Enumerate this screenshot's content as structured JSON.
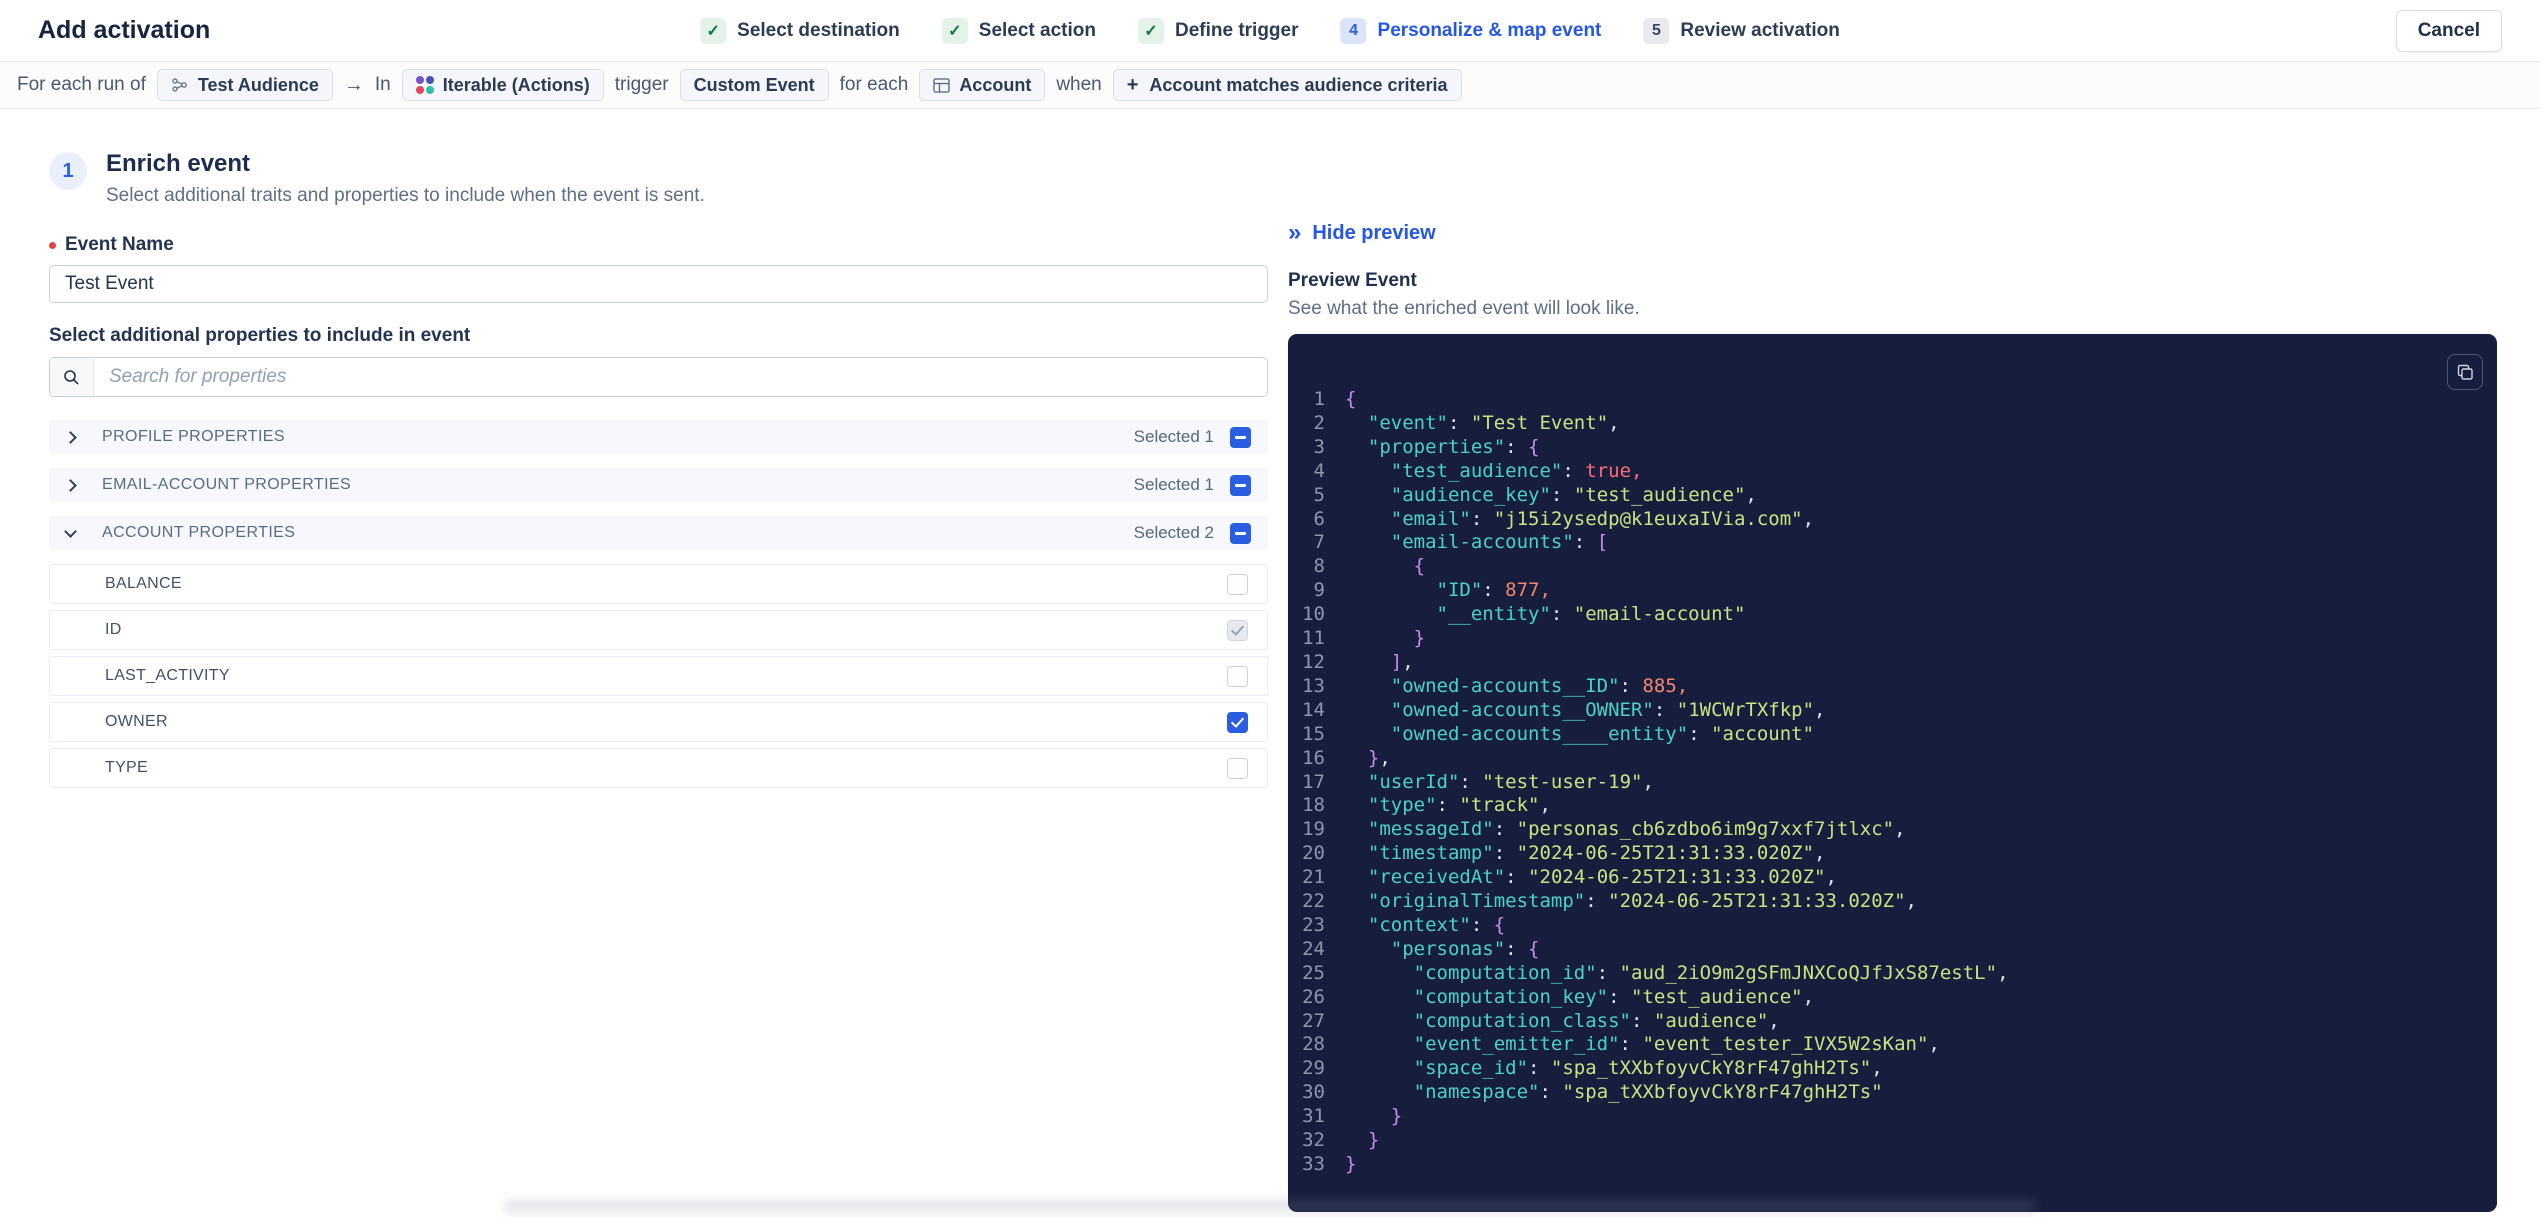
{
  "header": {
    "title": "Add activation",
    "cancel_label": "Cancel",
    "steps": [
      {
        "label": "Select destination",
        "state": "done"
      },
      {
        "label": "Select action",
        "state": "done"
      },
      {
        "label": "Define trigger",
        "state": "done"
      },
      {
        "number": "4",
        "label": "Personalize & map event",
        "state": "active"
      },
      {
        "number": "5",
        "label": "Review activation",
        "state": "upcoming"
      }
    ]
  },
  "icons": {
    "check": "✓",
    "arrow_right": "→",
    "double_chevron_right": "»",
    "plus": "+"
  },
  "context_bar": {
    "for_each_run_of": "For each run of",
    "audience_chip": "Test Audience",
    "in_label": "In",
    "destination_chip": "Iterable (Actions)",
    "trigger_label": "trigger",
    "trigger_chip": "Custom Event",
    "for_each_label": "for each",
    "entity_chip": "Account",
    "when_label": "when",
    "criteria_chip": "Account matches audience criteria"
  },
  "enrich": {
    "step_number": "1",
    "title": "Enrich event",
    "subtitle": "Select additional traits and properties to include when the event is sent.",
    "event_name_label": "Event Name",
    "event_name_value": "Test Event",
    "properties_label": "Select additional properties to include in event",
    "search_placeholder": "Search for properties",
    "groups": [
      {
        "label": "PROFILE PROPERTIES",
        "selected_text": "Selected 1",
        "state": "collapsed"
      },
      {
        "label": "EMAIL-ACCOUNT PROPERTIES",
        "selected_text": "Selected 1",
        "state": "collapsed"
      },
      {
        "label": "ACCOUNT PROPERTIES",
        "selected_text": "Selected 2",
        "state": "expanded"
      }
    ],
    "account_properties": [
      {
        "label": "BALANCE",
        "state": "unchecked"
      },
      {
        "label": "ID",
        "state": "checked-disabled"
      },
      {
        "label": "LAST_ACTIVITY",
        "state": "unchecked"
      },
      {
        "label": "OWNER",
        "state": "checked"
      },
      {
        "label": "TYPE",
        "state": "unchecked"
      }
    ]
  },
  "preview": {
    "hide_label": "Hide preview",
    "title": "Preview Event",
    "subtitle": "See what the enriched event will look like.",
    "code_lines": [
      [
        [
          "p",
          "{"
        ]
      ],
      [
        [
          "d",
          "  "
        ],
        [
          "k",
          "\"event\""
        ],
        [
          "d",
          ": "
        ],
        [
          "s",
          "\"Test Event\""
        ],
        [
          "d",
          ","
        ]
      ],
      [
        [
          "d",
          "  "
        ],
        [
          "k",
          "\"properties\""
        ],
        [
          "d",
          ": "
        ],
        [
          "p",
          "{"
        ]
      ],
      [
        [
          "d",
          "    "
        ],
        [
          "k",
          "\"test_audience\""
        ],
        [
          "d",
          ": "
        ],
        [
          "b",
          "true,"
        ]
      ],
      [
        [
          "d",
          "    "
        ],
        [
          "k",
          "\"audience_key\""
        ],
        [
          "d",
          ": "
        ],
        [
          "s",
          "\"test_audience\""
        ],
        [
          "d",
          ","
        ]
      ],
      [
        [
          "d",
          "    "
        ],
        [
          "k",
          "\"email\""
        ],
        [
          "d",
          ": "
        ],
        [
          "s",
          "\"j15i2ysedp@k1euxaIVia.com\""
        ],
        [
          "d",
          ","
        ]
      ],
      [
        [
          "d",
          "    "
        ],
        [
          "k",
          "\"email-accounts\""
        ],
        [
          "d",
          ": "
        ],
        [
          "p",
          "["
        ]
      ],
      [
        [
          "d",
          "      "
        ],
        [
          "p",
          "{"
        ]
      ],
      [
        [
          "d",
          "        "
        ],
        [
          "k",
          "\"ID\""
        ],
        [
          "d",
          ": "
        ],
        [
          "n",
          "877,"
        ]
      ],
      [
        [
          "d",
          "        "
        ],
        [
          "k",
          "\"__entity\""
        ],
        [
          "d",
          ": "
        ],
        [
          "s",
          "\"email-account\""
        ]
      ],
      [
        [
          "d",
          "      "
        ],
        [
          "p",
          "}"
        ]
      ],
      [
        [
          "d",
          "    "
        ],
        [
          "p",
          "]"
        ],
        [
          "d",
          ","
        ]
      ],
      [
        [
          "d",
          "    "
        ],
        [
          "k",
          "\"owned-accounts__ID\""
        ],
        [
          "d",
          ": "
        ],
        [
          "n",
          "885,"
        ]
      ],
      [
        [
          "d",
          "    "
        ],
        [
          "k",
          "\"owned-accounts__OWNER\""
        ],
        [
          "d",
          ": "
        ],
        [
          "s",
          "\"1WCWrTXfkp\""
        ],
        [
          "d",
          ","
        ]
      ],
      [
        [
          "d",
          "    "
        ],
        [
          "k",
          "\"owned-accounts____entity\""
        ],
        [
          "d",
          ": "
        ],
        [
          "s",
          "\"account\""
        ]
      ],
      [
        [
          "d",
          "  "
        ],
        [
          "p",
          "}"
        ],
        [
          "d",
          ","
        ]
      ],
      [
        [
          "d",
          "  "
        ],
        [
          "k",
          "\"userId\""
        ],
        [
          "d",
          ": "
        ],
        [
          "s",
          "\"test-user-19\""
        ],
        [
          "d",
          ","
        ]
      ],
      [
        [
          "d",
          "  "
        ],
        [
          "k",
          "\"type\""
        ],
        [
          "d",
          ": "
        ],
        [
          "s",
          "\"track\""
        ],
        [
          "d",
          ","
        ]
      ],
      [
        [
          "d",
          "  "
        ],
        [
          "k",
          "\"messageId\""
        ],
        [
          "d",
          ": "
        ],
        [
          "s",
          "\"personas_cb6zdbo6im9g7xxf7jtlxc\""
        ],
        [
          "d",
          ","
        ]
      ],
      [
        [
          "d",
          "  "
        ],
        [
          "k",
          "\"timestamp\""
        ],
        [
          "d",
          ": "
        ],
        [
          "s",
          "\"2024-06-25T21:31:33.020Z\""
        ],
        [
          "d",
          ","
        ]
      ],
      [
        [
          "d",
          "  "
        ],
        [
          "k",
          "\"receivedAt\""
        ],
        [
          "d",
          ": "
        ],
        [
          "s",
          "\"2024-06-25T21:31:33.020Z\""
        ],
        [
          "d",
          ","
        ]
      ],
      [
        [
          "d",
          "  "
        ],
        [
          "k",
          "\"originalTimestamp\""
        ],
        [
          "d",
          ": "
        ],
        [
          "s",
          "\"2024-06-25T21:31:33.020Z\""
        ],
        [
          "d",
          ","
        ]
      ],
      [
        [
          "d",
          "  "
        ],
        [
          "k",
          "\"context\""
        ],
        [
          "d",
          ": "
        ],
        [
          "p",
          "{"
        ]
      ],
      [
        [
          "d",
          "    "
        ],
        [
          "k",
          "\"personas\""
        ],
        [
          "d",
          ": "
        ],
        [
          "p",
          "{"
        ]
      ],
      [
        [
          "d",
          "      "
        ],
        [
          "k",
          "\"computation_id\""
        ],
        [
          "d",
          ": "
        ],
        [
          "s",
          "\"aud_2iO9m2gSFmJNXCoQJfJxS87estL\""
        ],
        [
          "d",
          ","
        ]
      ],
      [
        [
          "d",
          "      "
        ],
        [
          "k",
          "\"computation_key\""
        ],
        [
          "d",
          ": "
        ],
        [
          "s",
          "\"test_audience\""
        ],
        [
          "d",
          ","
        ]
      ],
      [
        [
          "d",
          "      "
        ],
        [
          "k",
          "\"computation_class\""
        ],
        [
          "d",
          ": "
        ],
        [
          "s",
          "\"audience\""
        ],
        [
          "d",
          ","
        ]
      ],
      [
        [
          "d",
          "      "
        ],
        [
          "k",
          "\"event_emitter_id\""
        ],
        [
          "d",
          ": "
        ],
        [
          "s",
          "\"event_tester_IVX5W2sKan\""
        ],
        [
          "d",
          ","
        ]
      ],
      [
        [
          "d",
          "      "
        ],
        [
          "k",
          "\"space_id\""
        ],
        [
          "d",
          ": "
        ],
        [
          "s",
          "\"spa_tXXbfoyvCkY8rF47ghH2Ts\""
        ],
        [
          "d",
          ","
        ]
      ],
      [
        [
          "d",
          "      "
        ],
        [
          "k",
          "\"namespace\""
        ],
        [
          "d",
          ": "
        ],
        [
          "s",
          "\"spa_tXXbfoyvCkY8rF47ghH2Ts\""
        ]
      ],
      [
        [
          "d",
          "    "
        ],
        [
          "p",
          "}"
        ]
      ],
      [
        [
          "d",
          "  "
        ],
        [
          "p",
          "}"
        ]
      ],
      [
        [
          "p",
          "}"
        ]
      ]
    ]
  },
  "colors": {
    "accent_blue": "#2b5de0",
    "success_green": "#0e7a3d",
    "code_bg": "#171e3d",
    "code_key": "#49d2c6",
    "code_string": "#c9e383",
    "code_number": "#f2876d",
    "code_boolean": "#fd6b78",
    "code_brace": "#c98ced"
  }
}
